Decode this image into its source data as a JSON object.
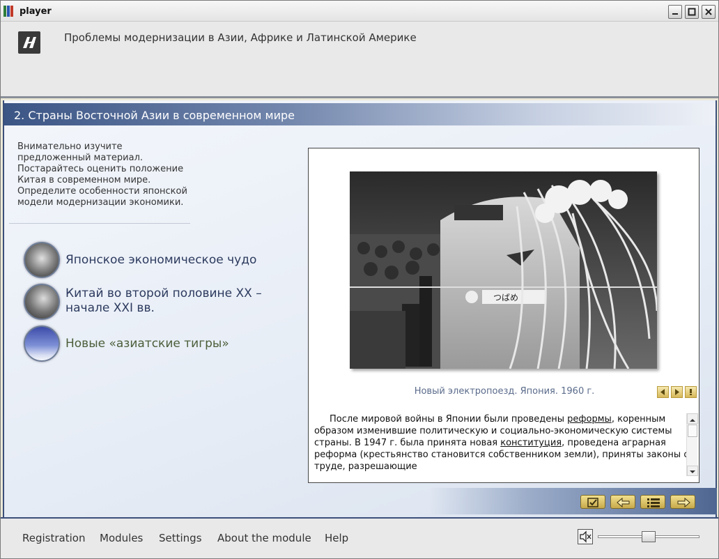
{
  "window": {
    "title": "player"
  },
  "header": {
    "course_title": "Проблемы модернизации в Азии, Африке и Латинской Америке"
  },
  "section": {
    "title": "2. Страны Восточной Азии в современном мире"
  },
  "instructions": "Внимательно изучите предложенный материал. Постарайтесь оценить положение Китая в современном мире. Определите особенности японской модели модернизации экономики.",
  "topics": [
    {
      "label": "Японское экономическое чудо"
    },
    {
      "label": "Китай во второй половине XX – начале XXI вв."
    },
    {
      "label": "Новые «азиатские тигры»"
    }
  ],
  "panel": {
    "photo_sign": "つばめ",
    "caption": "Новый электропоезд. Япония. 1960 г.",
    "text_part1": "После мировой войны в Японии были проведены ",
    "link1": "реформы",
    "text_part2": ", коренным образом изменившие политическую и социально-экономическую системы страны. В 1947 г. была принята новая ",
    "link2": "конституция",
    "text_part3": ", проведена аграрная реформа (крестьянство становится собственником земли), приняты законы о труде, разрешающие"
  },
  "footer": {
    "menu": [
      "Registration",
      "Modules",
      "Settings",
      "About the module",
      "Help"
    ],
    "volume": 0.5
  },
  "colors": {
    "accent": "#3b5585",
    "button_gold": "#d7b85a"
  }
}
